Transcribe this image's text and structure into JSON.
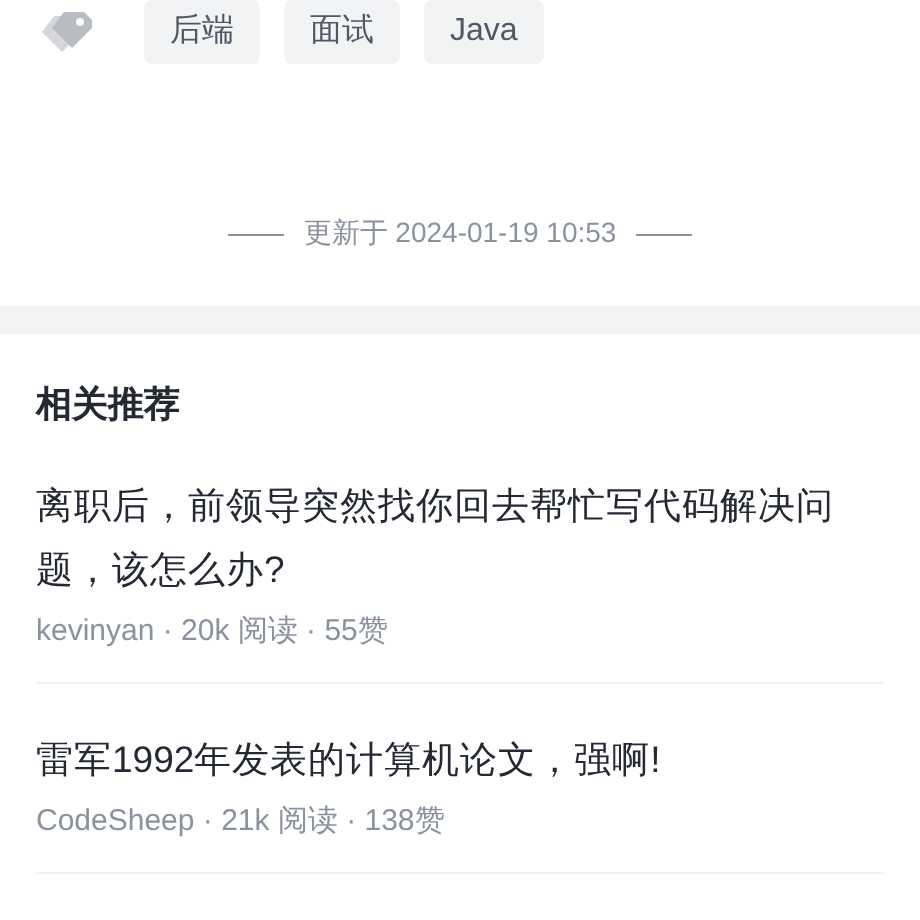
{
  "tags": [
    "后端",
    "面试",
    "Java"
  ],
  "updated": "更新于 2024-01-19 10:53",
  "recommend": {
    "title": "相关推荐",
    "articles": [
      {
        "title": "离职后，前领导突然找你回去帮忙写代码解决问题，该怎么办?",
        "meta": "kevinyan · 20k 阅读 · 55赞"
      },
      {
        "title": "雷军1992年发表的计算机论文，强啊!",
        "meta": "CodeSheep · 21k 阅读 · 138赞"
      }
    ]
  }
}
